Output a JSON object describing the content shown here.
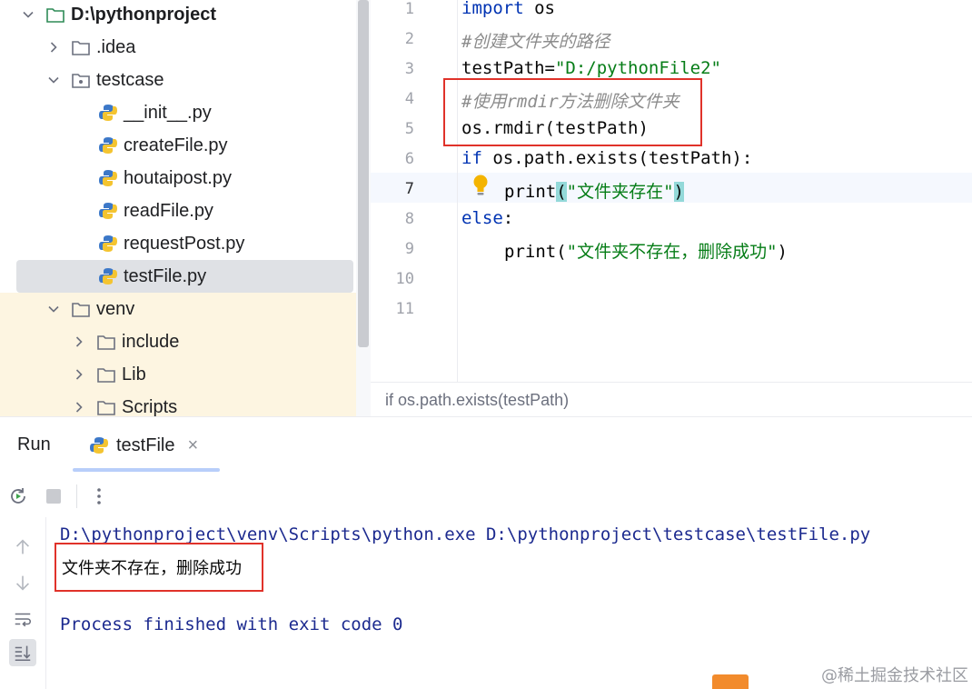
{
  "project_tree": {
    "items": [
      {
        "label": "D:\\pythonproject",
        "kind": "folder",
        "expanded": true
      },
      {
        "label": ".idea",
        "kind": "folder",
        "expanded": false
      },
      {
        "label": "testcase",
        "kind": "package",
        "expanded": true
      },
      {
        "label": "__init__.py",
        "kind": "python-file"
      },
      {
        "label": "createFile.py",
        "kind": "python-file"
      },
      {
        "label": "houtaipost.py",
        "kind": "python-file"
      },
      {
        "label": "readFile.py",
        "kind": "python-file"
      },
      {
        "label": "requestPost.py",
        "kind": "python-file"
      },
      {
        "label": "testFile.py",
        "kind": "python-file",
        "selected": true
      },
      {
        "label": "venv",
        "kind": "folder",
        "expanded": true
      },
      {
        "label": "include",
        "kind": "folder",
        "expanded": false
      },
      {
        "label": "Lib",
        "kind": "folder",
        "expanded": false
      },
      {
        "label": "Scripts",
        "kind": "folder",
        "expanded": false
      }
    ]
  },
  "editor": {
    "line_numbers": [
      "1",
      "2",
      "3",
      "4",
      "5",
      "6",
      "7",
      "8",
      "9",
      "10",
      "11"
    ],
    "active_line": "7",
    "lines": {
      "l1_kw": "import",
      "l1_rest": " os",
      "l2_comment": "#创建文件夹的路径",
      "l3_var": "testPath=",
      "l3_str": "\"D:/pythonFile2\"",
      "l4_comment": "#使用rmdir方法删除文件夹",
      "l5_code": "os.rmdir(testPath)",
      "l6_kw": "if",
      "l6_rest": " os.path.exists(testPath):",
      "l7_fn": "print",
      "l7_open": "(",
      "l7_str": "\"文件夹存在\"",
      "l7_close": ")",
      "l8_kw": "else",
      "l8_rest": ":",
      "l9_fn": "print",
      "l9_open": "(",
      "l9_str": "\"文件夹不存在，删除成功\"",
      "l9_close": ")"
    },
    "breadcrumb": "if os.path.exists(testPath)"
  },
  "run_panel": {
    "title": "Run",
    "tab_label": "testFile",
    "tab_close": "×",
    "console": {
      "command": "D:\\pythonproject\\venv\\Scripts\\python.exe D:\\pythonproject\\testcase\\testFile.py",
      "output": "文件夹不存在，删除成功",
      "exit_message": "Process finished with exit code 0"
    }
  },
  "watermark": "@稀土掘金技术社区",
  "colors": {
    "keyword": "#0033b3",
    "string": "#067d17",
    "comment": "#8c8c8c",
    "annotation_box": "#e0322a",
    "console_text": "#1c2a8f"
  }
}
